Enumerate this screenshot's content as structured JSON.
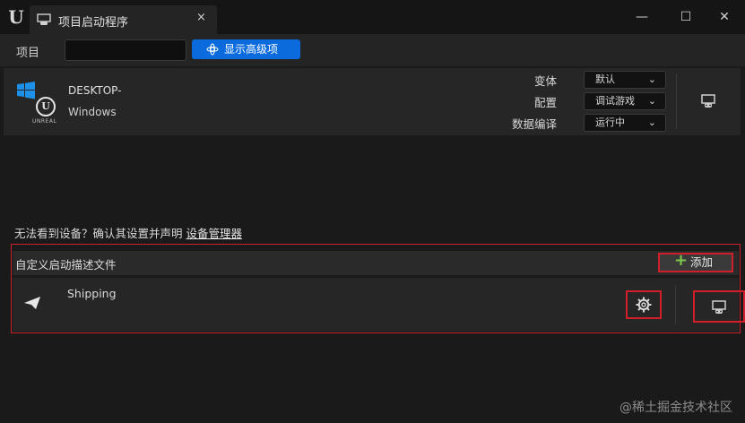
{
  "window": {
    "tab_title": "项目启动程序",
    "tab_close": "×",
    "minimize": "—",
    "maximize": "☐",
    "close": "✕"
  },
  "toolbar": {
    "project_label": "项目",
    "project_input_value": "",
    "advanced_button_label": "显示高级项"
  },
  "device": {
    "name": "DESKTOP-",
    "platform": "Windows",
    "unreal_text": "UNREAL",
    "options": {
      "variant_label": "变体",
      "variant_value": "默认",
      "config_label": "配置",
      "config_value": "调试游戏",
      "datacook_label": "数据编译",
      "datacook_value": "运行中"
    }
  },
  "help": {
    "text": "无法看到设备？确认其设置并声明 ",
    "link": "设备管理器"
  },
  "profiles": {
    "title": "自定义启动描述文件",
    "add_label": "添加",
    "items": [
      {
        "name": "Shipping"
      }
    ]
  },
  "watermark": "@稀土掘金技术社区",
  "colors": {
    "accent": "#0b6bdc",
    "highlight": "#d01e2a",
    "plus": "#7cc84a"
  }
}
